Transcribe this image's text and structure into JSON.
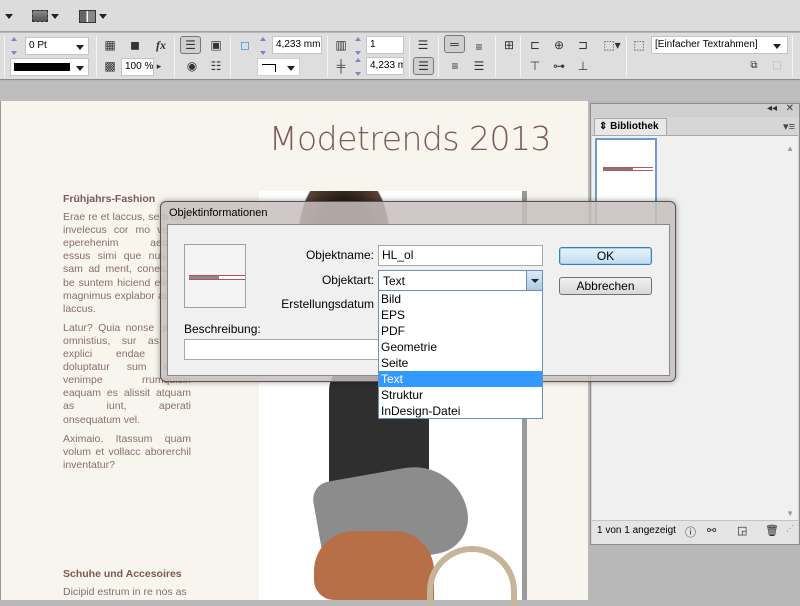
{
  "appbar": {
    "icons": [
      "dropdown-arrow",
      "screen-mode-icon",
      "arrange-documents-icon"
    ]
  },
  "control_panel": {
    "stroke_weight": "0 Pt",
    "stroke_color": "#000000",
    "opacity": "100 %",
    "fx_label": "fx",
    "inset_spacing": "4,233 mm",
    "columns": "1",
    "gutter": "4,233 m",
    "object_style": "[Einfacher Textrahmen]"
  },
  "document": {
    "title": "Modetrends 2013",
    "section1": {
      "heading": "Frühjahrs-Fashion",
      "paragraphs": [
        "Erae re et laccus, sem blab invelecus cor mo volupta eperehenim aecerum essus simi que nus ere, sam ad ment, coneturiosti be suntem hiciend eliso as magnimus explabor aut rae laccus.",
        "Latur? Quia nonse quiam, omnistius, sur as num explici endae atius doluptatur sum evella venimpe rrumquisin eaquam es alissit atquam as iunt, aperati onsequatum vel.",
        "Aximaio. Itassum quam volum et vollacc aborerchil inventatur?"
      ]
    },
    "section2": {
      "heading": "Schuhe und Accesoires",
      "paragraphs": [
        "Dicipid estrum in re nos as"
      ]
    }
  },
  "library_panel": {
    "tab_label": "Bibliothek",
    "count_text": "1 von 1 angezeigt",
    "collapse_glyph": "◂◂",
    "close_glyph": "✕",
    "menu_glyph": "▾≡"
  },
  "dialog": {
    "title": "Objektinformationen",
    "name_label": "Objektname:",
    "name_value": "HL_ol",
    "type_label": "Objektart:",
    "type_value": "Text",
    "date_label": "Erstellungsdatum",
    "desc_label": "Beschreibung:",
    "desc_value": "",
    "ok_label": "OK",
    "cancel_label": "Abbrechen",
    "type_options": [
      "Bild",
      "EPS",
      "PDF",
      "Geometrie",
      "Seite",
      "Text",
      "Struktur",
      "InDesign-Datei"
    ],
    "selected_option": "Text"
  }
}
